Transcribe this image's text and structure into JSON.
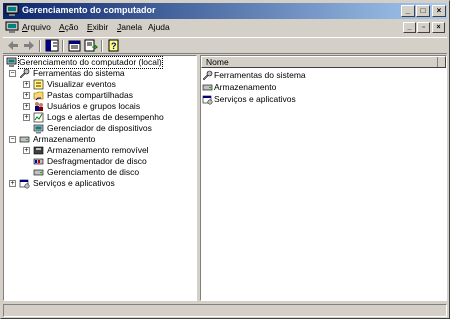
{
  "window": {
    "title": "Gerenciamento do computador"
  },
  "menu": {
    "items": [
      {
        "label": "Arquivo",
        "mnemonic": "A",
        "rest": "rquivo"
      },
      {
        "label": "Ação",
        "mnemonic": "A",
        "rest": "ção"
      },
      {
        "label": "Exibir",
        "mnemonic": "E",
        "rest": "xibir"
      },
      {
        "label": "Janela",
        "mnemonic": "J",
        "rest": "anela"
      },
      {
        "label": "Ajuda",
        "mnemonic": "j",
        "pre": "A",
        "rest": "uda"
      }
    ]
  },
  "tree": {
    "root": "Gerenciamento do computador (local)",
    "system_tools": "Ferramentas do sistema",
    "event_viewer": "Visualizar eventos",
    "shared_folders": "Pastas compartilhadas",
    "local_users": "Usuários e grupos locais",
    "perf_logs": "Logs e alertas de desempenho",
    "device_manager": "Gerenciador de dispositivos",
    "storage": "Armazenamento",
    "removable_storage": "Armazenamento removível",
    "defrag": "Desfragmentador de disco",
    "disk_mgmt": "Gerenciamento de disco",
    "services_apps": "Serviços e aplicativos"
  },
  "list": {
    "column_name": "Nome",
    "items": [
      "Ferramentas do sistema",
      "Armazenamento",
      "Serviços e aplicativos"
    ]
  },
  "colors": {
    "title_start": "#0a246a",
    "title_end": "#a6caf0",
    "face": "#d4d0c8"
  }
}
